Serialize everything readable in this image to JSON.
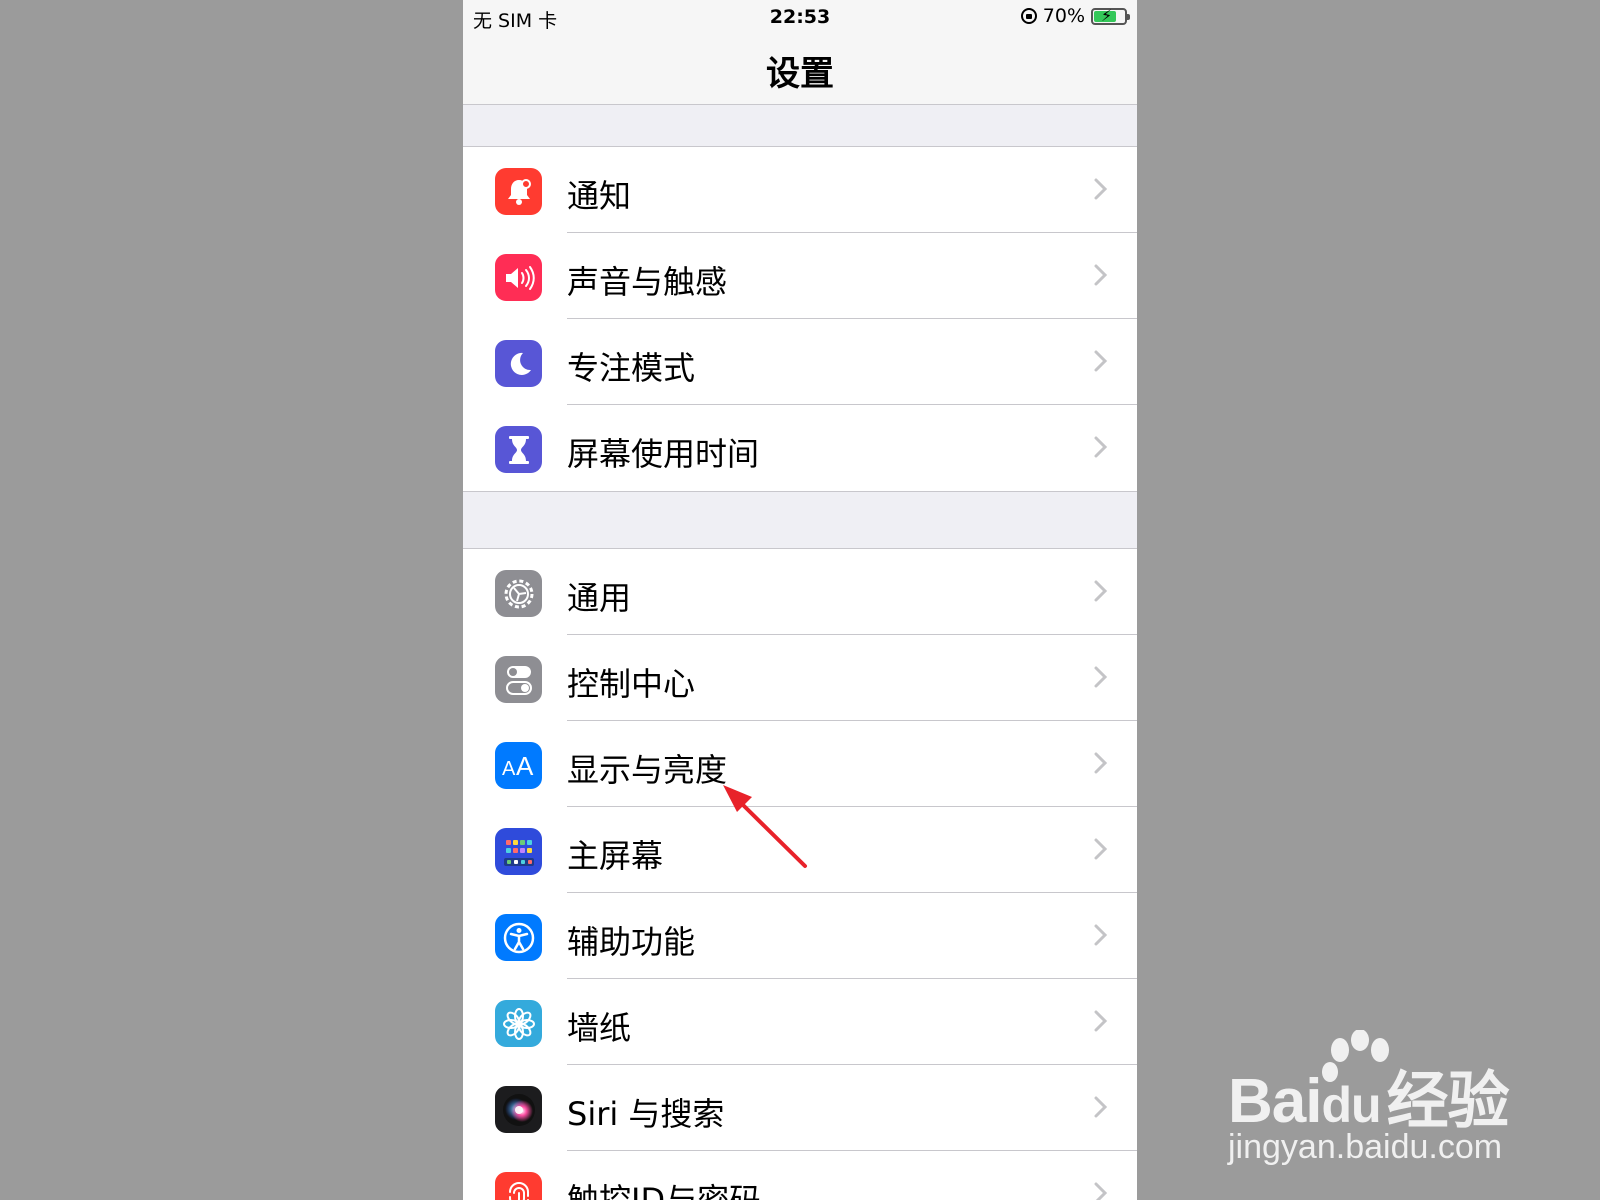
{
  "status": {
    "carrier": "无 SIM 卡",
    "time": "22:53",
    "battery": "70%",
    "battery_level": 0.7
  },
  "nav": {
    "title": "设置"
  },
  "groups": [
    {
      "items": [
        {
          "id": "notifications",
          "label": "通知",
          "icon": "bell-icon",
          "color": "#ff3b30"
        },
        {
          "id": "sounds",
          "label": "声音与触感",
          "icon": "speaker-icon",
          "color": "#ff2d55"
        },
        {
          "id": "focus",
          "label": "专注模式",
          "icon": "moon-icon",
          "color": "#5856d6"
        },
        {
          "id": "screen-time",
          "label": "屏幕使用时间",
          "icon": "hourglass-icon",
          "color": "#5856d6"
        }
      ]
    },
    {
      "items": [
        {
          "id": "general",
          "label": "通用",
          "icon": "gear-icon",
          "color": "#8e8e93"
        },
        {
          "id": "control-center",
          "label": "控制中心",
          "icon": "toggles-icon",
          "color": "#8e8e93"
        },
        {
          "id": "display",
          "label": "显示与亮度",
          "icon": "text-size-icon",
          "color": "#007aff"
        },
        {
          "id": "home-screen",
          "label": "主屏幕",
          "icon": "app-grid-icon",
          "color": "#2f4bdb"
        },
        {
          "id": "accessibility",
          "label": "辅助功能",
          "icon": "accessibility-icon",
          "color": "#007aff"
        },
        {
          "id": "wallpaper",
          "label": "墙纸",
          "icon": "flower-icon",
          "color": "#34aadc"
        },
        {
          "id": "siri",
          "label": "Siri 与搜索",
          "icon": "siri-icon",
          "color": "#1c1c1e"
        },
        {
          "id": "touch-id",
          "label": "触控ID与密码",
          "icon": "fingerprint-icon",
          "color": "#ff3b30"
        }
      ]
    }
  ],
  "annotation": {
    "color": "#e8222a",
    "target": "display"
  },
  "watermark": {
    "brand_left": "Bai",
    "brand_mid": "du",
    "brand_right": "经验",
    "site": "jingyan.baidu.com"
  }
}
